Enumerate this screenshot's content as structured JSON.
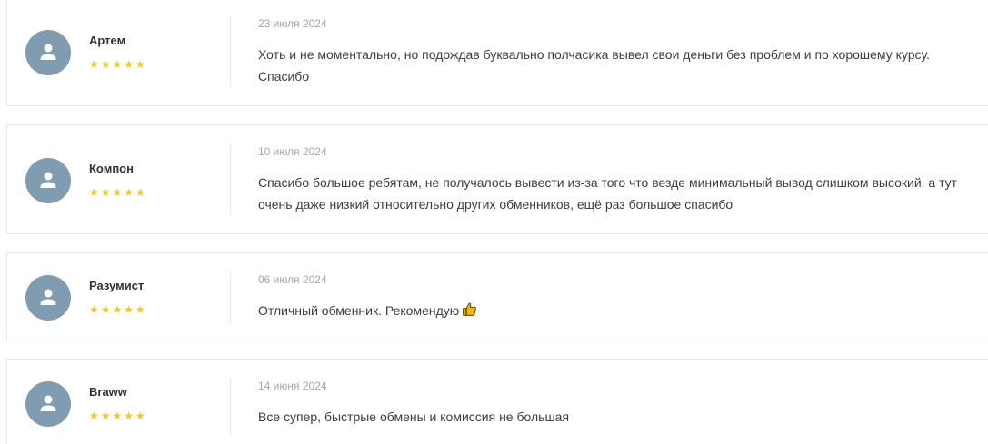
{
  "reviews": [
    {
      "author": "Артем",
      "stars": "★★★★★",
      "rating": 5,
      "date": "23 июля 2024",
      "text": "Хоть и не моментально, но подождав буквально полчасика вывел свои деньги без проблем и по хорошему курсу. Спасибо"
    },
    {
      "author": "Компон",
      "stars": "★★★★★",
      "rating": 5,
      "date": "10 июля 2024",
      "text": "Спасибо большое ребятам, не получалось вывести из-за того что везде минимальный вывод слишком высокий, а тут очень даже низкий относительно других обменников, ещё раз большое спасибо"
    },
    {
      "author": "Разумист",
      "stars": "★★★★★",
      "rating": 5,
      "date": "06 июля 2024",
      "text": "Отличный обменник. Рекомендую",
      "emoji": "thumbs-up-icon"
    },
    {
      "author": "Braww",
      "stars": "★★★★★",
      "rating": 5,
      "date": "14 июня 2024",
      "text": "Все супер, быстрые обмены и комиссия не большая"
    }
  ],
  "colors": {
    "avatar_bg": "#7f9cb1",
    "star": "#f3c623",
    "border": "#e6e6e6",
    "date": "#a6a6a6",
    "text": "#3d3d3d",
    "author": "#333333"
  }
}
